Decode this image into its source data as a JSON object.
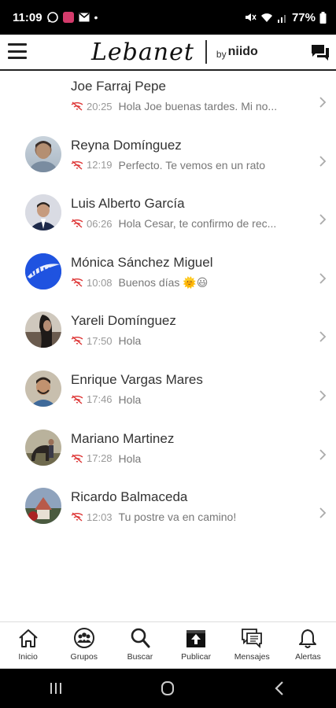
{
  "status_bar": {
    "time": "11:09",
    "battery": "77%"
  },
  "header": {
    "logo": "Lebanet",
    "by": "by",
    "brand": "niido"
  },
  "conversations": [
    {
      "name": "Joe Farraj Pepe",
      "time": "20:25",
      "preview": "Hola Joe buenas tardes. Mi no...",
      "avatar": "none"
    },
    {
      "name": "Reyna Domínguez",
      "time": "12:19",
      "preview": "Perfecto. Te vemos en un rato",
      "avatar": "photo"
    },
    {
      "name": "Luis Alberto García",
      "time": "06:26",
      "preview": "Hola Cesar, te confirmo de rec...",
      "avatar": "photo"
    },
    {
      "name": "Mónica Sánchez Miguel",
      "time": "10:08",
      "preview": "Buenos días 🌞😃",
      "avatar": "nike"
    },
    {
      "name": "Yareli Domínguez",
      "time": "17:50",
      "preview": "Hola",
      "avatar": "photo"
    },
    {
      "name": "Enrique Vargas Mares",
      "time": "17:46",
      "preview": "Hola",
      "avatar": "photo"
    },
    {
      "name": "Mariano Martinez",
      "time": "17:28",
      "preview": "Hola",
      "avatar": "photo"
    },
    {
      "name": "Ricardo Balmaceda",
      "time": "12:03",
      "preview": "Tu postre va en camino!",
      "avatar": "photo"
    }
  ],
  "bottom_nav": [
    {
      "label": "Inicio",
      "icon": "home-icon"
    },
    {
      "label": "Grupos",
      "icon": "groups-icon"
    },
    {
      "label": "Buscar",
      "icon": "search-icon"
    },
    {
      "label": "Publicar",
      "icon": "publish-icon"
    },
    {
      "label": "Mensajes",
      "icon": "messages-icon"
    },
    {
      "label": "Alertas",
      "icon": "bell-icon"
    }
  ]
}
